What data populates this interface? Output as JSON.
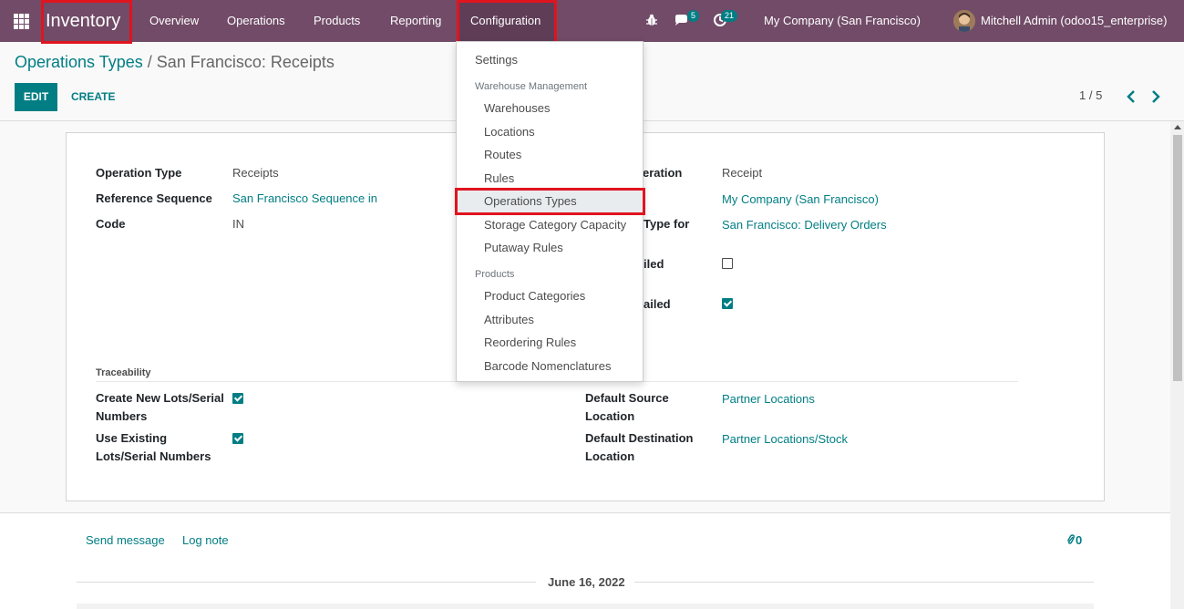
{
  "navbar": {
    "brand": "Inventory",
    "menu": [
      "Overview",
      "Operations",
      "Products",
      "Reporting",
      "Configuration"
    ],
    "messages_count": "5",
    "activities_count": "21",
    "company": "My Company (San Francisco)",
    "user": "Mitchell Admin (odoo15_enterprise)"
  },
  "breadcrumb": {
    "parent": "Operations Types",
    "separator": "/",
    "current": "San Francisco: Receipts"
  },
  "buttons": {
    "edit": "EDIT",
    "create": "CREATE"
  },
  "pager": {
    "value": "1 / 5"
  },
  "form": {
    "left": [
      {
        "label": "Operation Type",
        "value": "Receipts"
      },
      {
        "label": "Reference Sequence",
        "value": "San Francisco Sequence in"
      },
      {
        "label": "Code",
        "value": "IN"
      }
    ],
    "right": [
      {
        "label": "eration",
        "value": "Receipt"
      },
      {
        "label": "",
        "value": "My Company (San Francisco)"
      },
      {
        "label": "Type for",
        "value": "San Francisco: Delivery Orders"
      },
      {
        "label": "iled",
        "checked": false
      },
      {
        "label": "ailed",
        "checked": true
      }
    ],
    "traceability": {
      "title": "Traceability",
      "create_lots_label_1": "Create New Lots/Serial",
      "create_lots_label_2": "Numbers",
      "create_lots_checked": true,
      "use_existing_label_1": "Use Existing",
      "use_existing_label_2": "Lots/Serial Numbers",
      "use_existing_checked": true,
      "src_label_1": "Default Source",
      "src_label_2": "Location",
      "src_value": "Partner Locations",
      "dst_label_1": "Default Destination",
      "dst_label_2": "Location",
      "dst_value": "Partner Locations/Stock"
    }
  },
  "chatter": {
    "send_message": "Send message",
    "log_note": "Log note",
    "attachments": "0",
    "date": "June 16, 2022"
  },
  "dropdown": {
    "settings": "Settings",
    "header_warehouse": "Warehouse Management",
    "warehouse_items": [
      "Warehouses",
      "Locations",
      "Routes",
      "Rules",
      "Operations Types",
      "Storage Category Capacity",
      "Putaway Rules"
    ],
    "header_products": "Products",
    "product_items": [
      "Product Categories",
      "Attributes",
      "Reordering Rules",
      "Barcode Nomenclatures"
    ]
  },
  "colors": {
    "navbar": "#714b67",
    "accent": "#017e84",
    "highlight": "#e0141e"
  }
}
